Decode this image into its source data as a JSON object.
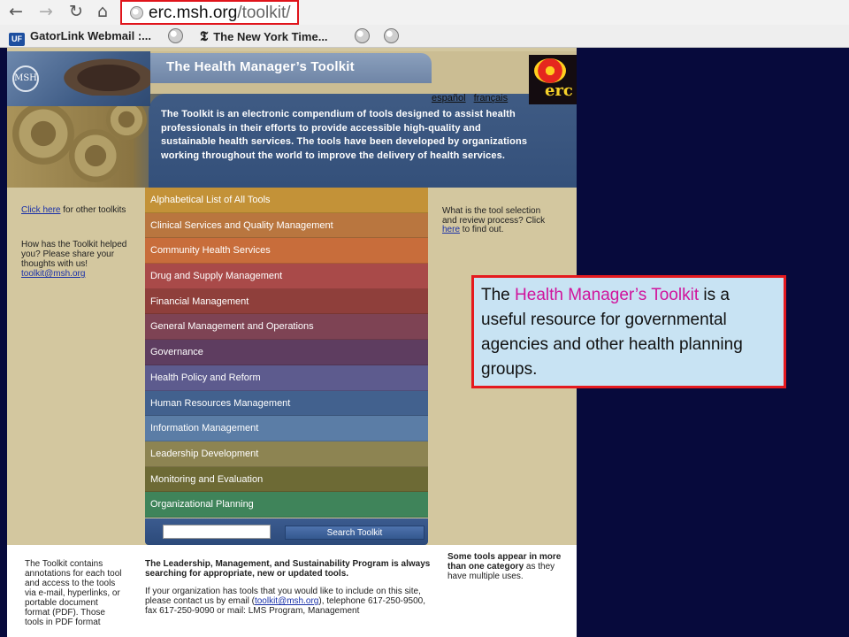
{
  "browser": {
    "url_domain": "erc.msh.org",
    "url_path": "/toolkit/",
    "bookmarks": [
      {
        "label": "GatorLink Webmail :...",
        "icon": "uf-icon",
        "badge": "UF"
      },
      {
        "label": "The New York Time...",
        "icon": "nyt-icon",
        "badge": "𝕿"
      }
    ]
  },
  "page": {
    "logo_text": "MSH",
    "title": "The Health Manager’s Toolkit",
    "erc_logo_text": "erc",
    "lang_links": [
      "español",
      "français"
    ],
    "intro": "The Toolkit is an electronic compendium of tools designed to assist health professionals in their efforts to provide accessible high-quality and sustainable health services. The tools have been developed by organizations working throughout the world to improve the delivery of health services.",
    "left_col": {
      "click_here": "Click here",
      "other_toolkits": " for other toolkits",
      "helped": "How has the Toolkit helped you? Please share your thoughts with us!",
      "email": "toolkit@msh.org"
    },
    "right_col": {
      "text": "What is the tool selection and review process? Click ",
      "link": "here",
      "suffix": " to find out."
    },
    "menu": [
      {
        "label": "Alphabetical List of All Tools",
        "color": "#c39238"
      },
      {
        "label": "Clinical Services and Quality Management",
        "color": "#b9763f"
      },
      {
        "label": "Community Health Services",
        "color": "#c86d3b"
      },
      {
        "label": "Drug and Supply Management",
        "color": "#a94a49"
      },
      {
        "label": "Financial Management",
        "color": "#8f3f3b"
      },
      {
        "label": "General Management and Operations",
        "color": "#7e4354"
      },
      {
        "label": "Governance",
        "color": "#5e3d60"
      },
      {
        "label": "Health Policy and Reform",
        "color": "#5d5b8e"
      },
      {
        "label": "Human Resources Management",
        "color": "#42618e"
      },
      {
        "label": "Information Management",
        "color": "#5b7da6"
      },
      {
        "label": "Leadership Development",
        "color": "#8d8452"
      },
      {
        "label": "Monitoring and Evaluation",
        "color": "#6d6a35"
      },
      {
        "label": "Organizational Planning",
        "color": "#3f845a"
      }
    ],
    "search_button": "Search Toolkit",
    "bottom": {
      "left": "The Toolkit contains annotations for each tool and access to the tools via e-mail, hyperlinks, or portable document format (PDF). Those tools in PDF format",
      "mid_bold": "The Leadership, Management, and Sustainability Program is always searching for appropriate, new or updated tools.",
      "mid_p1": "If your organization has tools that you would like to include on this site, please contact us by email (",
      "mid_email": "toolkit@msh.org",
      "mid_p2": "), telephone 617-250-9500, fax 617-250-9090 or mail: LMS Program, Management",
      "right_bold": "Some tools appear in more than one category",
      "right_rest": " as they have multiple uses."
    }
  },
  "callout": {
    "pre": "The ",
    "highlight": "Health Manager’s Toolkit",
    "post": " is a useful resource for governmental agencies and other health planning groups.",
    "highlight_color": "#d0149c"
  }
}
